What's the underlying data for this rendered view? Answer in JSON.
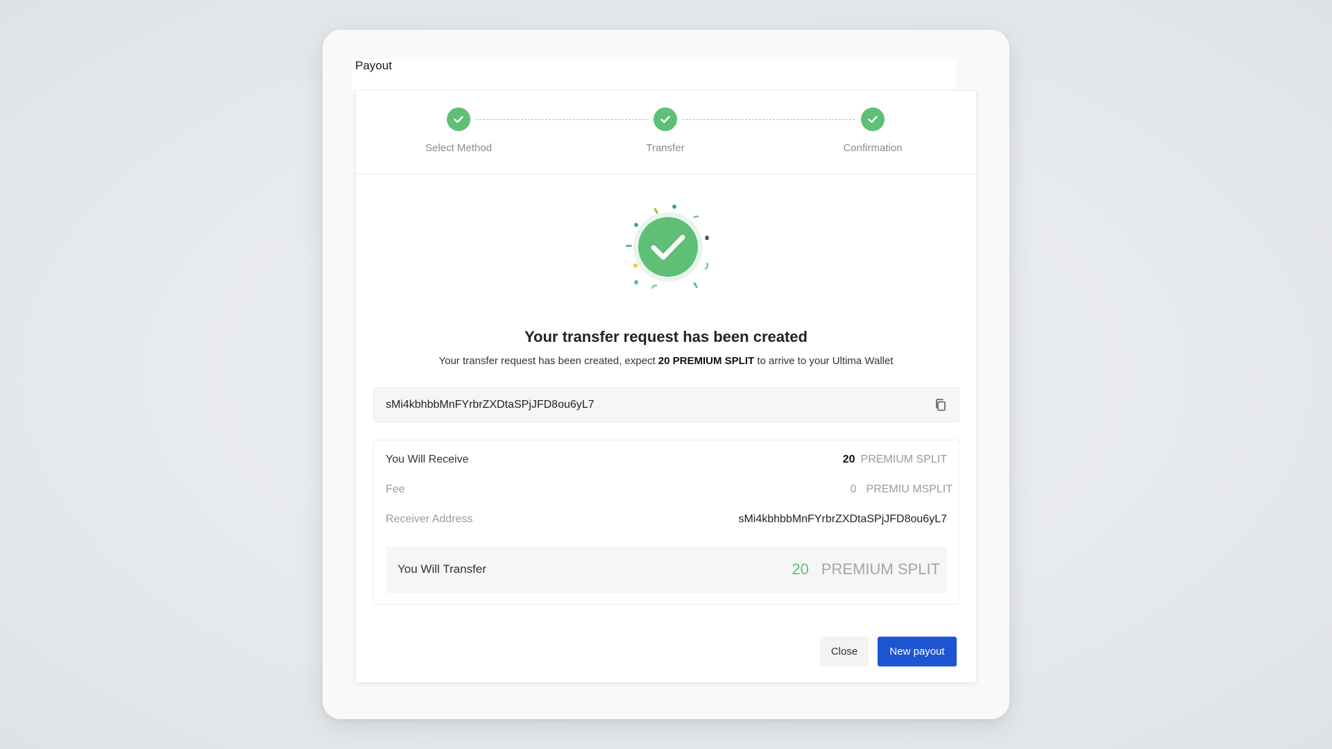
{
  "modal": {
    "title": "Payout"
  },
  "stepper": {
    "steps": [
      {
        "label": "Select Method",
        "status": "complete",
        "icon": "check-icon"
      },
      {
        "label": "Transfer",
        "status": "complete",
        "icon": "check-icon"
      },
      {
        "label": "Confirmation",
        "status": "complete",
        "icon": "check-icon"
      }
    ]
  },
  "success": {
    "icon": "success-check-icon",
    "headline": "Your transfer request has been created",
    "sub_prefix": "Your transfer request has been created, expect ",
    "sub_amount": "20 PREMIUM SPLIT",
    "sub_suffix": " to arrive to your Ultima Wallet"
  },
  "address_box": {
    "address": "sMi4kbhbbMnFYrbrZXDtaSPjJFD8ou6yL7",
    "copy_icon": "copy-icon"
  },
  "summary": {
    "receive": {
      "label": "You Will Receive",
      "amount": "20",
      "unit": "PREMIUM SPLIT"
    },
    "fee": {
      "label": "Fee",
      "amount": "0",
      "unit": "PREMIU MSPLIT"
    },
    "receiver": {
      "label": "Receiver Address",
      "value": "sMi4kbhbbMnFYrbrZXDtaSPjJFD8ou6yL7"
    },
    "transfer": {
      "label": "You Will Transfer",
      "amount": "20",
      "unit": "PREMIUM SPLIT"
    }
  },
  "actions": {
    "close_label": "Close",
    "new_payout_label": "New payout"
  },
  "colors": {
    "success_green": "#5fbf77",
    "primary_blue": "#1e56d2"
  }
}
